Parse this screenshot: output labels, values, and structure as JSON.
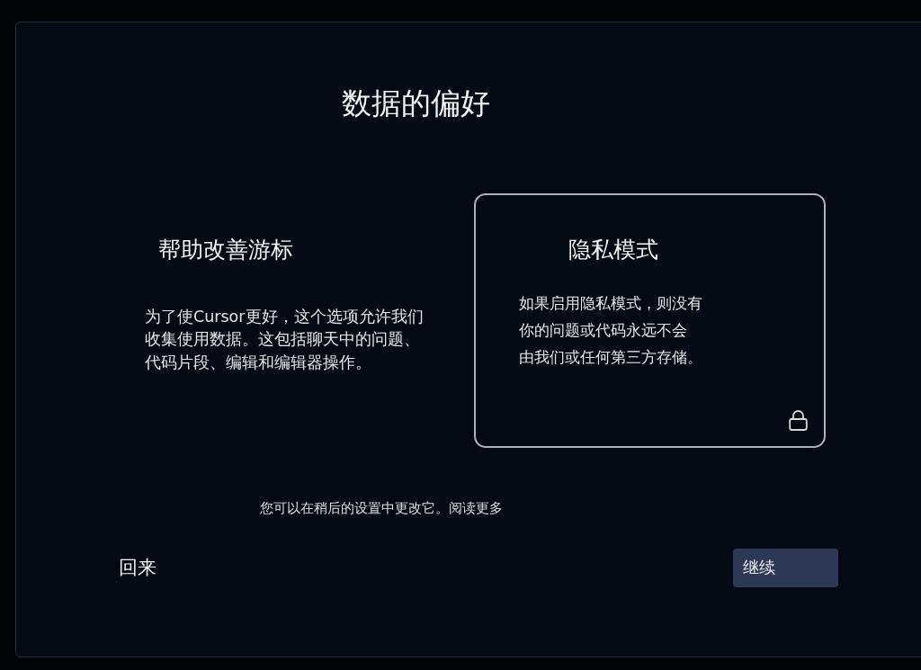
{
  "title": "数据的偏好",
  "options": [
    {
      "kind": "share",
      "title": "帮助改善游标",
      "description": [
        "为了使Cursor更好，这个选项允许我们",
        "收集使用数据。这包括聊天中的问题、",
        "代码片段、编辑和编辑器操作。"
      ],
      "selected": false
    },
    {
      "kind": "privacy",
      "title": "隐私模式",
      "description": [
        "如果启用隐私模式，则没有",
        "你的问题或代码永远不会",
        "由我们或任何第三方存储。"
      ],
      "selected": true
    }
  ],
  "note": {
    "text": "您可以在稍后的设置中更改它。",
    "link": "阅读更多"
  },
  "buttons": [
    {
      "kind": "back",
      "label": "回来"
    },
    {
      "kind": "continue",
      "label": "继续"
    }
  ]
}
